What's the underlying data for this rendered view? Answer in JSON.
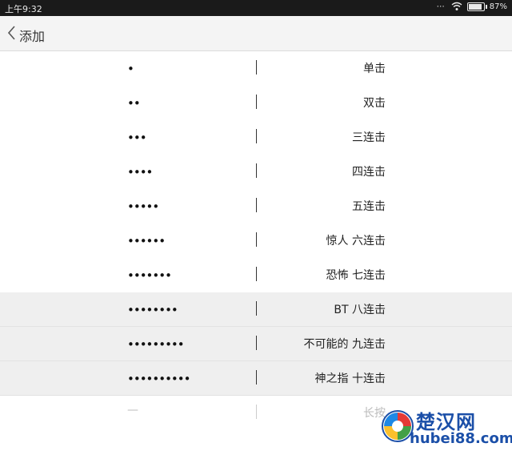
{
  "status_bar": {
    "time": "上午9:32",
    "battery_percent": "87%",
    "battery_level": 0.87
  },
  "header": {
    "title": "添加"
  },
  "rows": [
    {
      "dots": "•",
      "label": "单击"
    },
    {
      "dots": "••",
      "label": "双击"
    },
    {
      "dots": "•••",
      "label": "三连击"
    },
    {
      "dots": "••••",
      "label": "四连击"
    },
    {
      "dots": "•••••",
      "label": "五连击"
    },
    {
      "dots": "••••••",
      "label": "惊人 六连击"
    },
    {
      "dots": "•••••••",
      "label": "恐怖 七连击"
    },
    {
      "dots": "••••••••",
      "label": "BT 八连击"
    },
    {
      "dots": "•••••••••",
      "label": "不可能的 九连击"
    },
    {
      "dots": "••••••••••",
      "label": "神之指 十连击"
    },
    {
      "dots": "—",
      "label": "长按"
    }
  ],
  "watermark": {
    "name": "楚汉网",
    "url": "hubei88.com"
  },
  "colors": {
    "status_bar_bg": "#1a1a1a",
    "header_bg": "#f4f4f4",
    "highlight_row_bg": "#efefef",
    "watermark_blue": "#1b4fa8"
  }
}
